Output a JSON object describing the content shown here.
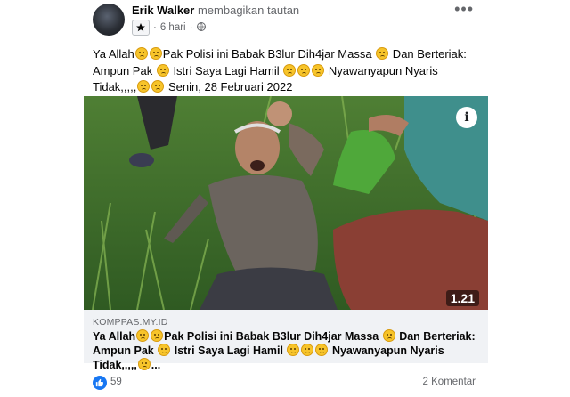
{
  "post": {
    "author": "Erik Walker",
    "action": "membagikan tautan",
    "time": "6 hari",
    "separator": "·",
    "more_label": "•••",
    "text_parts": [
      "Ya Allah",
      "Pak Polisi ini Babak B3lur Dih4jar Massa ",
      " Dan Berteriak: Ampun Pak ",
      " Istri Saya Lagi Hamil ",
      " Nyawanyapun Nyaris Tidak,,,,,",
      " Senin, 28 Februari 2022"
    ]
  },
  "media": {
    "info_label": "i",
    "duration": "1.21"
  },
  "link": {
    "domain": "KOMPPAS.MY.ID",
    "title_parts": [
      "Ya Allah",
      "Pak Polisi ini Babak B3lur Dih4jar Massa ",
      " Dan Berteriak: Ampun Pak ",
      " Istri Saya Lagi Hamil ",
      " Nyawanyapun Nyaris Tidak,,,,,",
      "..."
    ]
  },
  "footer": {
    "likes": "59",
    "comments": "2 Komentar"
  },
  "icons": {
    "emoji": "crying-face-emoji",
    "star": "star-icon",
    "globe": "globe-icon",
    "like": "thumbs-up-icon"
  },
  "colors": {
    "like_blue": "#1877f2",
    "secondary_text": "#65676b",
    "link_bg": "#f0f2f5"
  }
}
